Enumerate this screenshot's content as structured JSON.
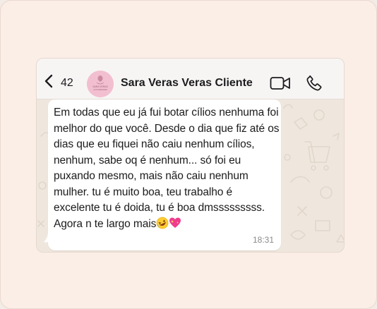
{
  "header": {
    "back_icon": "chevron-left-icon",
    "unread_count": "42",
    "contact_name": "Sara Veras Veras Cliente",
    "avatar_text_top": "SARA VERAS",
    "avatar_text_bottom": "LASH DESIGNER",
    "video_icon": "video-camera-icon",
    "call_icon": "phone-icon"
  },
  "message": {
    "text": "Em todas que eu já fui botar cílios nenhuma foi melhor do que você. Desde o dia que fiz até os dias que eu fiquei não caiu nenhum cílios, nenhum, sabe oq é nenhum... só foi eu puxando mesmo, mais não caiu nenhum mulher. tu é muito boa, teu trabalho é excelente tu é doida, tu é boa dmsssssssss. Agora n te largo mais",
    "emojis": [
      "rolling-on-floor-laughing-emoji",
      "sparkling-heart-emoji"
    ],
    "time": "18:31"
  },
  "colors": {
    "page_bg": "#fbeee7",
    "chat_bg": "#efe7de",
    "bubble_bg": "#ffffff",
    "header_bg": "#f7f5f4",
    "avatar_bg": "#f2bfd0"
  }
}
